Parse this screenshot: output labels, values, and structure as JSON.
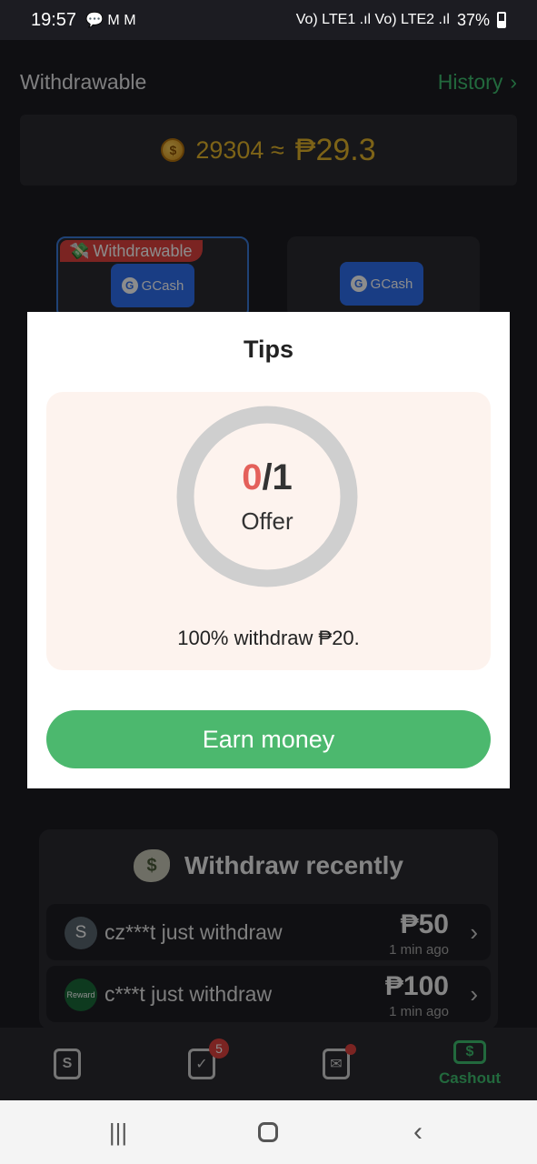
{
  "status_bar": {
    "time": "19:57",
    "notif_icons": "💬 M M",
    "signal": "Vo) LTE1 .ıl Vo) LTE2 .ıl",
    "battery": "37%"
  },
  "header": {
    "title": "Withdrawable",
    "history_label": "History",
    "history_chevron": "›"
  },
  "balance": {
    "coins": "29304 ≈",
    "peso": "₱29.3",
    "coin_symbol": "$"
  },
  "methods": [
    {
      "tag": "Withdrawable",
      "name": "GCash",
      "selected": true
    },
    {
      "name": "GCash",
      "selected": false
    }
  ],
  "modal": {
    "title": "Tips",
    "progress_done": "0",
    "progress_total": "/1",
    "progress_fraction": 0,
    "progress_unit": "Offer",
    "note": "100% withdraw ₱20.",
    "button": "Earn money"
  },
  "recent": {
    "heading": "Withdraw recently",
    "rows": [
      {
        "avatar": "S",
        "text": "cz***t just withdraw",
        "amount": "₱50",
        "time": "1 min ago"
      },
      {
        "avatar": "Reward",
        "text": "c***t just withdraw",
        "amount": "₱100",
        "time": "1 min ago"
      }
    ]
  },
  "tabbar": {
    "tabs": [
      {
        "icon": "wallet-icon",
        "label": ""
      },
      {
        "icon": "task-check-icon",
        "label": "",
        "badge": "5"
      },
      {
        "icon": "mail-icon",
        "label": ""
      },
      {
        "icon": "cash-icon",
        "label": "Cashout",
        "active": true
      }
    ]
  },
  "colors": {
    "accent_green": "#4cb86e",
    "gold": "#e3b52b",
    "red": "#e4605a",
    "gcash_blue": "#2f6ff0"
  }
}
